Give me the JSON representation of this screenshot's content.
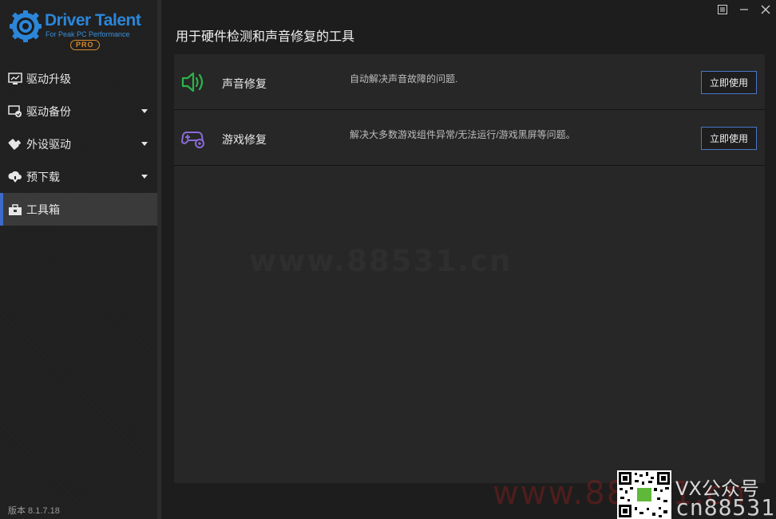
{
  "app": {
    "logo_title": "Driver Talent",
    "logo_subtitle": "For Peak PC Performance",
    "logo_badge": "PRO",
    "version": "版本 8.1.7.18"
  },
  "sidebar": {
    "items": [
      {
        "label": "驱动升级",
        "icon": "monitor-icon",
        "has_arrow": false,
        "active": false
      },
      {
        "label": "驱动备份",
        "icon": "backup-icon",
        "has_arrow": true,
        "active": false
      },
      {
        "label": "外设驱动",
        "icon": "usb-icon",
        "has_arrow": true,
        "active": false
      },
      {
        "label": "预下载",
        "icon": "cloud-download-icon",
        "has_arrow": true,
        "active": false
      },
      {
        "label": "工具箱",
        "icon": "toolbox-icon",
        "has_arrow": false,
        "active": true
      }
    ]
  },
  "main": {
    "title": "用于硬件检测和声音修复的工具",
    "tools": [
      {
        "name": "声音修复",
        "description": "自动解决声音故障的问题.",
        "button": "立即使用",
        "icon": "speaker-icon",
        "color": "#2db34a"
      },
      {
        "name": "游戏修复",
        "description": "解决大多数游戏组件异常/无法运行/游戏黑屏等问题。",
        "button": "立即使用",
        "icon": "gamepad-icon",
        "color": "#8a6ad8"
      }
    ]
  },
  "watermarks": {
    "center": "www.88531.cn",
    "bottom": "www.88531.cn",
    "vx_line1": "VX公众号",
    "vx_line2": "cn88531"
  },
  "colors": {
    "accent": "#3d6bc7",
    "brand": "#2b86d9",
    "pro": "#d98a2b"
  }
}
